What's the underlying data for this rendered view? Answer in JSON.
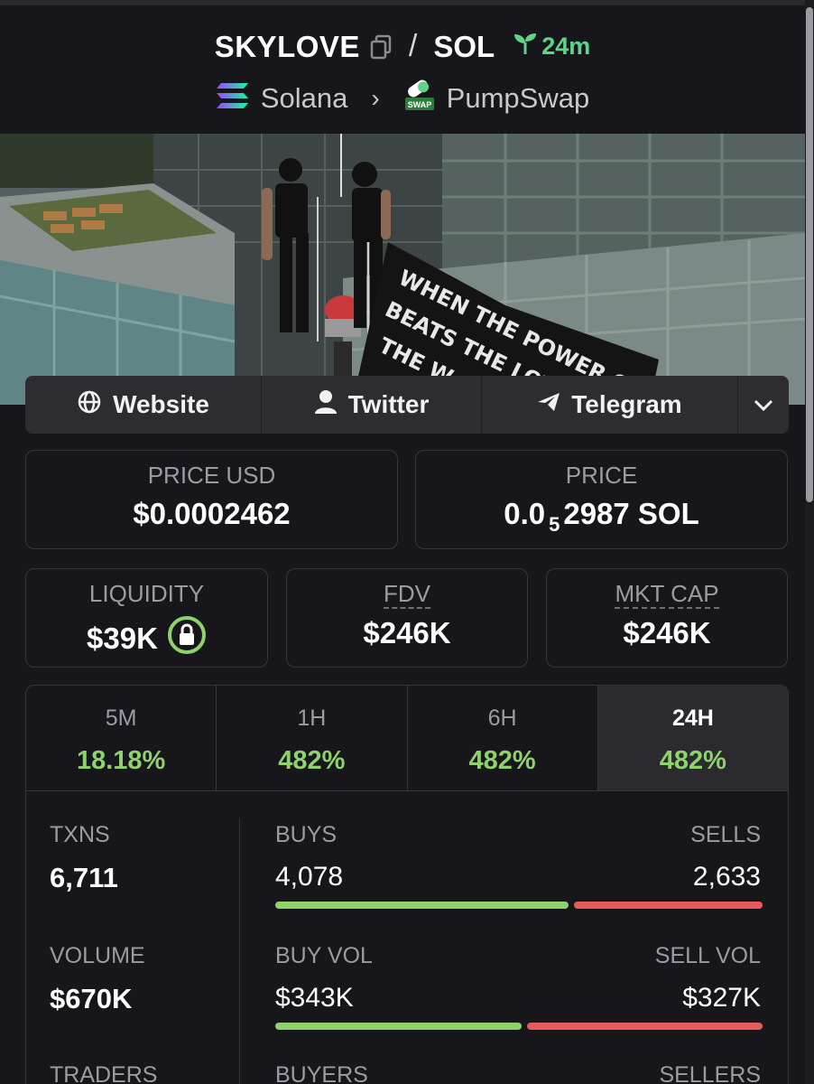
{
  "header": {
    "token_symbol": "SKYLOVE",
    "separator": "/",
    "quote_symbol": "SOL",
    "age": "24m",
    "chain": "Solana",
    "dex": "PumpSwap",
    "dex_badge": "SWAP"
  },
  "banner": {
    "text_line1": "WHEN THE POWER OF LOVE",
    "text_line2": "BEATS THE LOVE OF",
    "text_line3": "THE W"
  },
  "links": {
    "website": "Website",
    "twitter": "Twitter",
    "telegram": "Telegram"
  },
  "price": {
    "usd_label": "PRICE USD",
    "usd_value": "$0.0002462",
    "native_label": "PRICE",
    "native_prefix": "0.0",
    "native_zeros": "5",
    "native_digits": "2987 SOL"
  },
  "metrics": {
    "liquidity_label": "LIQUIDITY",
    "liquidity_value": "$39K",
    "fdv_label": "FDV",
    "fdv_value": "$246K",
    "mcap_label": "MKT CAP",
    "mcap_value": "$246K"
  },
  "timeframes": [
    {
      "label": "5M",
      "value": "18.18%"
    },
    {
      "label": "1H",
      "value": "482%"
    },
    {
      "label": "6H",
      "value": "482%"
    },
    {
      "label": "24H",
      "value": "482%"
    }
  ],
  "stats": {
    "txns_label": "TXNS",
    "txns_value": "6,711",
    "buys_label": "BUYS",
    "buys_value": "4,078",
    "sells_label": "SELLS",
    "sells_value": "2,633",
    "buys_fraction": 0.608,
    "volume_label": "VOLUME",
    "volume_value": "$670K",
    "buy_vol_label": "BUY VOL",
    "buy_vol_value": "$343K",
    "sell_vol_label": "SELL VOL",
    "sell_vol_value": "$327K",
    "buy_vol_fraction": 0.512,
    "traders_label": "TRADERS",
    "buyers_label": "BUYERS",
    "sellers_label": "SELLERS"
  },
  "colors": {
    "background": "#17171b",
    "positive": "#8fd16a",
    "negative": "#e55a5a",
    "age_green": "#5fd38a"
  },
  "icons": [
    "copy-icon",
    "seedling-icon",
    "solana-logo-icon",
    "chevron-right-icon",
    "pumpswap-logo-icon",
    "globe-icon",
    "user-icon",
    "send-icon",
    "chevron-down-icon",
    "lock-icon"
  ]
}
